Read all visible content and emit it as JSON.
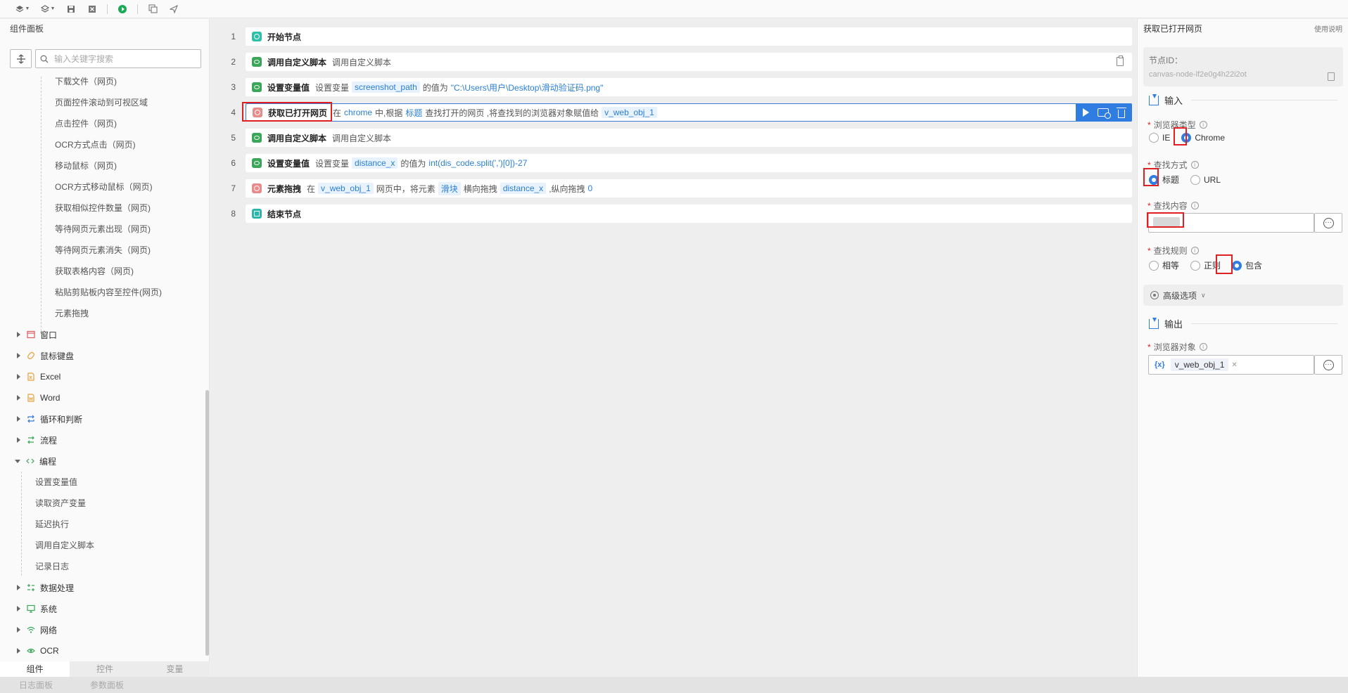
{
  "toolbar": {
    "buttons": [
      "layers-dropdown",
      "layers-alt-dropdown",
      "save",
      "close",
      "run",
      "copy",
      "send"
    ]
  },
  "left_panel": {
    "title": "组件面板",
    "search_placeholder": "输入关键字搜索",
    "web_items": [
      "下载文件（网页)",
      "页面控件滚动到可视区域",
      "点击控件（网页)",
      "OCR方式点击（网页)",
      "移动鼠标（网页)",
      "OCR方式移动鼠标（网页)",
      "获取相似控件数量（网页)",
      "等待网页元素出现（网页)",
      "等待网页元素消失（网页)",
      "获取表格内容（网页)",
      "粘贴剪贴板内容至控件(网页)",
      "元素拖拽"
    ],
    "categories_top": [
      {
        "label": "窗口",
        "icon": "window-icon",
        "color": "#e05a5a"
      },
      {
        "label": "鼠标键盘",
        "icon": "mouse-icon",
        "color": "#e8a13a"
      },
      {
        "label": "Excel",
        "icon": "excel-icon",
        "color": "#e8a13a"
      },
      {
        "label": "Word",
        "icon": "word-icon",
        "color": "#e8a13a"
      },
      {
        "label": "循环和判断",
        "icon": "loop-icon",
        "color": "#3a7bd5"
      },
      {
        "label": "流程",
        "icon": "flow-icon",
        "color": "#3aa657"
      }
    ],
    "coding": {
      "label": "编程",
      "items": [
        "设置变量值",
        "读取资产变量",
        "延迟执行",
        "调用自定义脚本",
        "记录日志"
      ]
    },
    "categories_bottom": [
      {
        "label": "数据处理",
        "icon": "data-process-icon",
        "color": "#3aa657"
      },
      {
        "label": "系统",
        "icon": "system-icon",
        "color": "#3aa657"
      },
      {
        "label": "网络",
        "icon": "network-icon",
        "color": "#3aa657"
      },
      {
        "label": "OCR",
        "icon": "ocr-icon",
        "color": "#3aa657"
      }
    ],
    "bottom_tabs": [
      "组件",
      "控件",
      "变量"
    ],
    "active_tab": "组件"
  },
  "status_bar": {
    "tabs": [
      "日志面板",
      "参数面板"
    ]
  },
  "flow": {
    "rows": [
      {
        "num": "1",
        "title": "开始节点",
        "icon": "start-icon",
        "color": "teal"
      },
      {
        "num": "2",
        "title": "调用自定义脚本",
        "desc": "调用自定义脚本",
        "icon": "script-icon",
        "color": "green"
      },
      {
        "num": "3",
        "title": "设置变量值",
        "desc_a": "设置变量",
        "var": "screenshot_path",
        "desc_b": "的值为",
        "value": "\"C:\\Users\\用户\\Desktop\\滑动验证码.png\"",
        "icon": "variable-icon",
        "color": "green"
      },
      {
        "num": "4",
        "title": "获取已打开网页",
        "p1": "在",
        "browser": "chrome",
        "p2": "中,根据",
        "mode": "标题",
        "p3": "查找打开的网页 ,将查找到的浏览器对象赋值给",
        "var": "v_web_obj_1",
        "icon": "webpage-icon",
        "color": "red"
      },
      {
        "num": "5",
        "title": "调用自定义脚本",
        "desc": "调用自定义脚本",
        "icon": "script-icon",
        "color": "green"
      },
      {
        "num": "6",
        "title": "设置变量值",
        "desc_a": "设置变量",
        "var": "distance_x",
        "desc_b": "的值为",
        "value": "int(dis_code.split(',')[0])-27",
        "icon": "variable-icon",
        "color": "green"
      },
      {
        "num": "7",
        "title": "元素拖拽",
        "p1": "在",
        "obj": "v_web_obj_1",
        "p2": "网页中，将元素",
        "elem": "滑块",
        "p3": "横向拖拽",
        "dist": "distance_x",
        "p4": ",纵向拖拽",
        "dy": "0",
        "icon": "drag-icon",
        "color": "red"
      },
      {
        "num": "8",
        "title": "结束节点",
        "icon": "end-icon",
        "color": "cyan"
      }
    ]
  },
  "right_panel": {
    "title": "获取已打开网页",
    "help": "使用说明",
    "node_id_label": "节点ID：",
    "node_id": "canvas-node-lf2e0g4h22i2ot",
    "input_section": "输入",
    "browser_type": {
      "label": "浏览器类型",
      "options": [
        "IE",
        "Chrome"
      ],
      "selected": "Chrome"
    },
    "find_mode": {
      "label": "查找方式",
      "options": [
        "标题",
        "URL"
      ],
      "selected": "标题"
    },
    "find_content": {
      "label": "查找内容",
      "value": ""
    },
    "find_rule": {
      "label": "查找规则",
      "options": [
        "相等",
        "正则",
        "包含"
      ],
      "selected": "包含"
    },
    "advanced": "高级选项",
    "output_section": "输出",
    "browser_obj": {
      "label": "浏览器对象",
      "var_icon": "{x}",
      "value": "v_web_obj_1"
    }
  },
  "accent_color": "#2f7de1",
  "highlight_box_color": "#e02020"
}
